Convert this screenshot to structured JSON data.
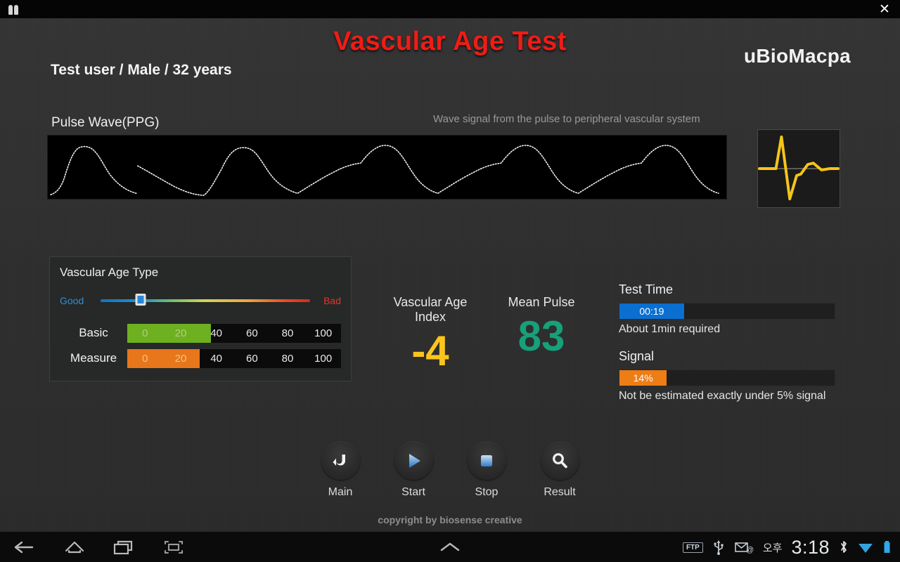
{
  "window": {
    "app_icon": "people-icon",
    "close_label": "✕"
  },
  "header": {
    "title": "Vascular Age Test",
    "brand": "uBioMacpa",
    "user_info": "Test user / Male / 32 years"
  },
  "ppg": {
    "label": "Pulse Wave(PPG)",
    "caption": "Wave signal from the pulse to peripheral vascular system"
  },
  "vascular_age_type": {
    "title": "Vascular Age Type",
    "slider": {
      "good_label": "Good",
      "bad_label": "Bad",
      "value_percent": 19
    },
    "rows": [
      {
        "label": "Basic",
        "fill_percent": 39,
        "fill_color": "#6db020",
        "ticks": [
          "0",
          "20",
          "40",
          "60",
          "80",
          "100"
        ]
      },
      {
        "label": "Measure",
        "fill_percent": 34,
        "fill_color": "#e8761a",
        "ticks": [
          "0",
          "20",
          "40",
          "60",
          "80",
          "100"
        ]
      }
    ]
  },
  "metrics": {
    "index_label": "Vascular Age Index",
    "index_value": "-4",
    "index_color": "#fdc41c",
    "pulse_label": "Mean Pulse",
    "pulse_value": "83",
    "pulse_color": "#17a07a"
  },
  "test_time": {
    "title": "Test Time",
    "value": "00:19",
    "percent": 30,
    "color": "#0a6fd0",
    "note": "About 1min required"
  },
  "signal": {
    "title": "Signal",
    "value": "14%",
    "percent": 22,
    "color": "#ef7d16",
    "note": "Not be estimated exactly under 5% signal"
  },
  "controls": [
    {
      "label": "Main",
      "icon": "back-arrow-icon"
    },
    {
      "label": "Start",
      "icon": "play-icon"
    },
    {
      "label": "Stop",
      "icon": "stop-square-icon"
    },
    {
      "label": "Result",
      "icon": "magnifier-icon"
    }
  ],
  "footer": {
    "copyright": "copyright by biosense creative"
  },
  "system_bar": {
    "ftp": "FTP",
    "ampm": "오후",
    "time": "3:18"
  }
}
